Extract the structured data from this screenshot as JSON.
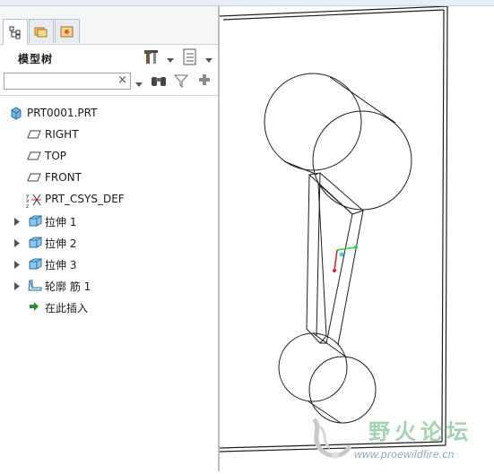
{
  "model_tree": {
    "title": "模型树",
    "search": {
      "value": "",
      "placeholder": ""
    },
    "items": [
      {
        "label": "PRT0001.PRT",
        "icon": "part-icon",
        "expandable": false
      },
      {
        "label": "RIGHT",
        "icon": "datum-plane-icon",
        "expandable": false
      },
      {
        "label": "TOP",
        "icon": "datum-plane-icon",
        "expandable": false
      },
      {
        "label": "FRONT",
        "icon": "datum-plane-icon",
        "expandable": false
      },
      {
        "label": "PRT_CSYS_DEF",
        "icon": "coordinate-system-icon",
        "expandable": false
      },
      {
        "label": "拉伸 1",
        "icon": "extrude-icon",
        "expandable": true
      },
      {
        "label": "拉伸 2",
        "icon": "extrude-icon",
        "expandable": true
      },
      {
        "label": "拉伸 3",
        "icon": "extrude-icon",
        "expandable": true
      },
      {
        "label": "轮廓 筋 1",
        "icon": "rib-icon",
        "expandable": true
      },
      {
        "label": "在此插入",
        "icon": "insert-here-arrow-icon",
        "expandable": false
      }
    ]
  },
  "watermark": {
    "name": "野火论坛",
    "url": "www.proewildfire.cn"
  },
  "colors": {
    "tree_line": "#1e1e1e",
    "insert_arrow": "#2e8b2e",
    "csys_green": "#2ecc40",
    "csys_red": "#e02020",
    "csys_cyan": "#40d0e0"
  }
}
